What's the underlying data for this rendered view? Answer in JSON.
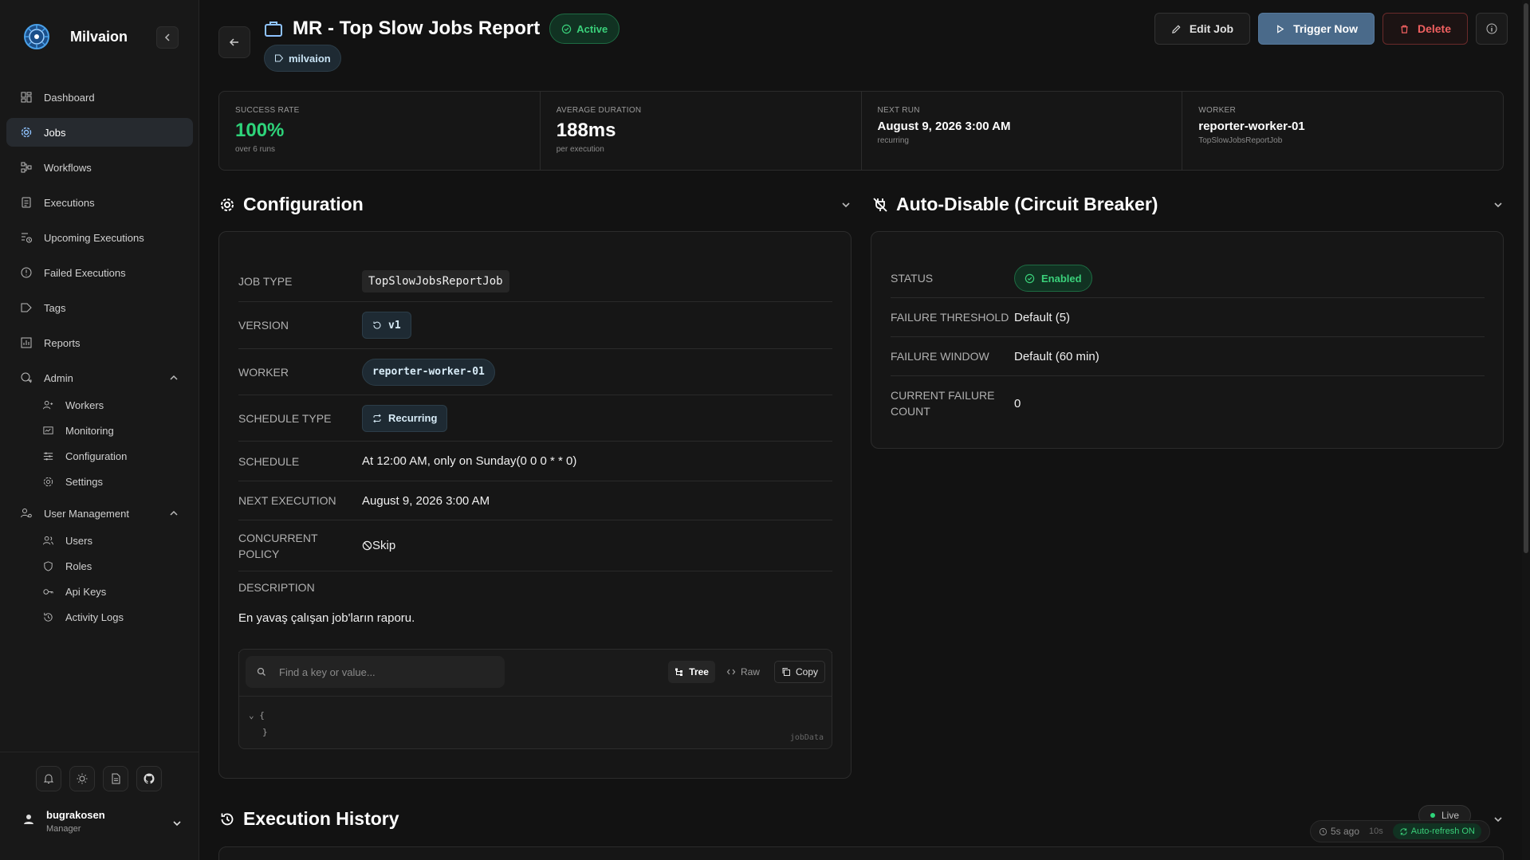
{
  "brand": {
    "name": "Milvaion"
  },
  "sidebar": {
    "items": [
      {
        "label": "Dashboard",
        "icon": "dashboard-icon"
      },
      {
        "label": "Jobs",
        "icon": "gear-icon",
        "active": true
      },
      {
        "label": "Workflows",
        "icon": "workflow-icon"
      },
      {
        "label": "Executions",
        "icon": "executions-icon"
      },
      {
        "label": "Upcoming Executions",
        "icon": "upcoming-icon"
      },
      {
        "label": "Failed Executions",
        "icon": "alert-circle-icon"
      },
      {
        "label": "Tags",
        "icon": "tag-icon"
      },
      {
        "label": "Reports",
        "icon": "chart-icon"
      }
    ],
    "admin": {
      "label": "Admin",
      "items": [
        {
          "label": "Workers",
          "icon": "workers-icon"
        },
        {
          "label": "Monitoring",
          "icon": "monitoring-icon"
        },
        {
          "label": "Configuration",
          "icon": "sliders-icon"
        },
        {
          "label": "Settings",
          "icon": "settings-icon"
        }
      ]
    },
    "user_management": {
      "label": "User Management",
      "items": [
        {
          "label": "Users",
          "icon": "users-icon"
        },
        {
          "label": "Roles",
          "icon": "shield-icon"
        },
        {
          "label": "Api Keys",
          "icon": "key-icon"
        },
        {
          "label": "Activity Logs",
          "icon": "history-icon"
        }
      ]
    }
  },
  "user": {
    "name": "bugrakosen",
    "role": "Manager"
  },
  "header": {
    "title": "MR - Top Slow Jobs Report",
    "status": "Active",
    "tag": "milvaion",
    "edit_label": "Edit Job",
    "trigger_label": "Trigger Now",
    "delete_label": "Delete"
  },
  "stats": {
    "success_rate": {
      "label": "SUCCESS RATE",
      "value": "100%",
      "sub": "over 6 runs"
    },
    "avg_duration": {
      "label": "AVERAGE DURATION",
      "value": "188ms",
      "sub": "per execution"
    },
    "next_run": {
      "label": "NEXT RUN",
      "value": "August 9, 2026 3:00 AM",
      "sub": "recurring"
    },
    "worker": {
      "label": "WORKER",
      "value": "reporter-worker-01",
      "sub": "TopSlowJobsReportJob"
    }
  },
  "configuration": {
    "title": "Configuration",
    "job_type": {
      "label": "JOB TYPE",
      "value": "TopSlowJobsReportJob"
    },
    "version": {
      "label": "VERSION",
      "value": "v1"
    },
    "worker": {
      "label": "WORKER",
      "value": "reporter-worker-01"
    },
    "schedule_type": {
      "label": "SCHEDULE TYPE",
      "value": "Recurring"
    },
    "schedule": {
      "label": "SCHEDULE",
      "value": "At 12:00 AM, only on Sunday(0 0 0 * * 0)"
    },
    "next_execution": {
      "label": "NEXT EXECUTION",
      "value": "August 9, 2026 3:00 AM"
    },
    "concurrent_policy": {
      "label": "CONCURRENT POLICY",
      "value": "Skip"
    },
    "description": {
      "label": "DESCRIPTION",
      "value": "En yavaş çalışan job'ların raporu."
    },
    "json": {
      "placeholder": "Find a key or value...",
      "tree_label": "Tree",
      "raw_label": "Raw",
      "copy_label": "Copy",
      "open_brace": "{",
      "close_brace": "}",
      "name": "jobData"
    }
  },
  "auto_disable": {
    "title": "Auto-Disable (Circuit Breaker)",
    "status": {
      "label": "STATUS",
      "value": "Enabled"
    },
    "failure_threshold": {
      "label": "FAILURE THRESHOLD",
      "value": "Default (5)"
    },
    "failure_window": {
      "label": "FAILURE WINDOW",
      "value": "Default (60 min)"
    },
    "current_failure_count": {
      "label": "CURRENT FAILURE COUNT",
      "value": "0"
    }
  },
  "execution_history": {
    "title": "Execution History",
    "live_label": "Live",
    "last_refresh": "5s ago",
    "interval": "10s",
    "auto_refresh": "Auto-refresh ON"
  },
  "colors": {
    "accent": "#4a6a8a",
    "success": "#2ed47a",
    "danger": "#f06060",
    "background": "#121212"
  }
}
